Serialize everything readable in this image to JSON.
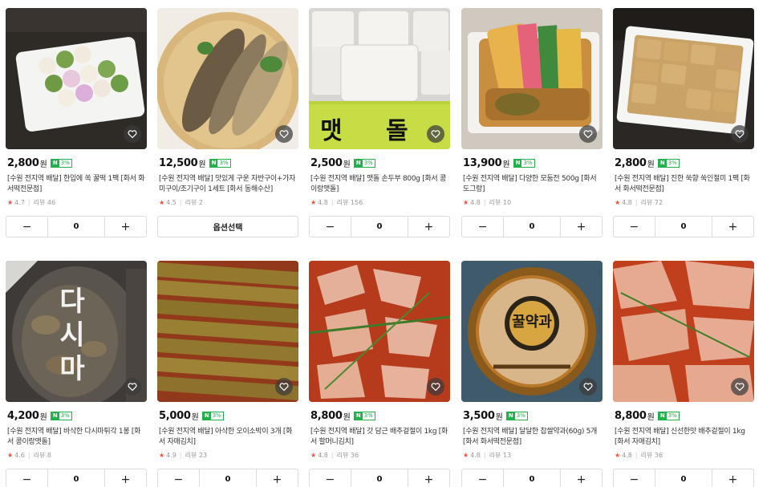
{
  "currency_unit": "원",
  "badge": {
    "n": "N",
    "pct": "3%"
  },
  "review_prefix": "리뷰",
  "stepper": {
    "minus": "−",
    "plus": "+"
  },
  "colors": {
    "badge_green": "#23b14d",
    "star_red": "#f04e3e",
    "border": "#dcdcdc"
  },
  "products": [
    {
      "price": "2,800",
      "title": "[수원 전지역 배달] 한입에 쏙 꿀떡 1팩 [화서 화서떡전문점]",
      "rating": "4.7",
      "reviews": "46",
      "control": "stepper",
      "qty": "0"
    },
    {
      "price": "12,500",
      "title": "[수원 전지역 배달] 맛있게 구운 자반구이+가자미구이/조기구이 1세트 [화서 동해수산]",
      "rating": "4.5",
      "reviews": "2",
      "control": "option",
      "option_label": "옵션선택"
    },
    {
      "price": "2,500",
      "title": "[수원 전지역 배달] 맷돌 손두부 800g [화서 콩이랑맷돌]",
      "rating": "4.8",
      "reviews": "156",
      "control": "stepper",
      "qty": "0"
    },
    {
      "price": "13,900",
      "title": "[수원 전지역 배달] 다양한 모둠전 500g [화서 도그랑]",
      "rating": "4.8",
      "reviews": "10",
      "control": "stepper",
      "qty": "0"
    },
    {
      "price": "2,800",
      "title": "[수원 전지역 배달] 진한 쑥향 쑥인절미 1팩 [화서 화서떡전문점]",
      "rating": "4.8",
      "reviews": "72",
      "control": "stepper",
      "qty": "0"
    },
    {
      "price": "4,200",
      "title": "[수원 전지역 배달] 바삭한 다시마튀각 1봉 [화서 콩이랑맷돌]",
      "rating": "4.6",
      "reviews": "8",
      "control": "stepper",
      "qty": "0"
    },
    {
      "price": "5,000",
      "title": "[수원 전지역 배달] 아삭한 오이소박이 3개 [화서 자매김치]",
      "rating": "4.9",
      "reviews": "23",
      "control": "stepper",
      "qty": "0"
    },
    {
      "price": "8,800",
      "title": "[수원 전지역 배달] 갓 담근 배추겉절이 1kg [화서 할머니김치]",
      "rating": "4.8",
      "reviews": "36",
      "control": "stepper",
      "qty": "0"
    },
    {
      "price": "3,500",
      "title": "[수원 전지역 배달] 달달한 찹쌀약과(60g) 5개 [화서 화서떡전문점]",
      "rating": "4.8",
      "reviews": "13",
      "control": "stepper",
      "qty": "0"
    },
    {
      "price": "8,800",
      "title": "[수원 전지역 배달] 신선한맛 배추겉절이 1kg [화서 자매김치]",
      "rating": "4.8",
      "reviews": "36",
      "control": "stepper",
      "qty": "0"
    }
  ],
  "image_text": {
    "img2": "맷 돌",
    "img5": "다시마",
    "img8": "꿀약과"
  }
}
